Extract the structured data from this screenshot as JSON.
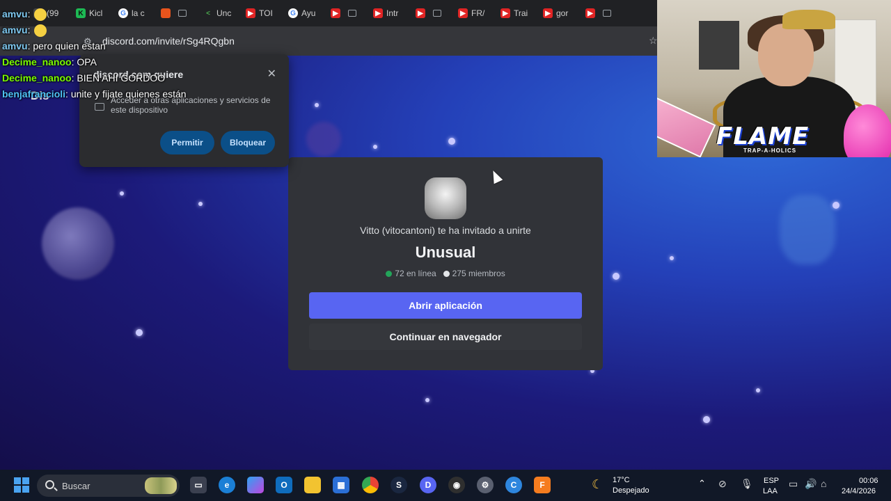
{
  "browser": {
    "tabs": [
      {
        "label": "(99",
        "icon": "pinned-icon"
      },
      {
        "label": "Kicl",
        "icon": "kick-icon"
      },
      {
        "label": "la c",
        "icon": "google-icon"
      },
      {
        "label": "",
        "icon": "soundcloud-icon"
      },
      {
        "label": "Unc",
        "icon": "arrow-icon"
      },
      {
        "label": "TOI",
        "icon": "youtube-icon"
      },
      {
        "label": "Ayu",
        "icon": "google-icon"
      },
      {
        "label": "",
        "icon": "youtube-icon"
      },
      {
        "label": "Intr",
        "icon": "youtube-icon"
      },
      {
        "label": "",
        "icon": "youtube-icon"
      },
      {
        "label": "FR/",
        "icon": "youtube-icon"
      },
      {
        "label": "Trai",
        "icon": "youtube-icon"
      },
      {
        "label": "gor",
        "icon": "youtube-icon"
      },
      {
        "label": "",
        "icon": "youtube-icon"
      }
    ],
    "address": "discord.com/invite/rSg4RQgbn"
  },
  "permission_popup": {
    "title": "discord.com quiere",
    "description": "Acceder a otras aplicaciones y servicios de este dispositivo",
    "allow_label": "Permitir",
    "block_label": "Bloquear"
  },
  "discord_logo": "Dis",
  "invite": {
    "inviter_text": "Vitto (vitocantoni) te ha invitado a unirte",
    "server_name": "Unusual",
    "online": "72 en línea",
    "members": "275 miembros",
    "open_app_label": "Abrir aplicación",
    "continue_label": "Continuar en navegador",
    "accent_color": "#5865f2"
  },
  "chat": [
    {
      "user": "amvu",
      "text": ""
    },
    {
      "user": "amvu",
      "text": ""
    },
    {
      "user": "amvu",
      "text": "pero quien estan"
    },
    {
      "user": "Decime_nanoo",
      "text": "OPA"
    },
    {
      "user": "Decime_nanoo",
      "text": "BIEN AHI GORDOO"
    },
    {
      "user": "benjafrancioli",
      "text": "unite y fijate quienes están"
    }
  ],
  "stream_overlay": {
    "title": "FLAME",
    "subtitle": "TRAP-A-HOLICS"
  },
  "taskbar": {
    "search_placeholder": "Buscar",
    "apps": [
      "file-explorer-icon",
      "edge-icon",
      "copilot-icon",
      "outlook-icon",
      "folder-icon",
      "store-icon",
      "chrome-icon",
      "steam-icon",
      "discord-icon",
      "obs-icon",
      "settings-icon",
      "ccleaner-icon",
      "fl-studio-icon"
    ],
    "weather_temp": "17°C",
    "weather_condition": "Despejado",
    "language_top": "ESP",
    "language_bottom": "LAA",
    "time": "00:06",
    "date": "24/4/2026"
  }
}
